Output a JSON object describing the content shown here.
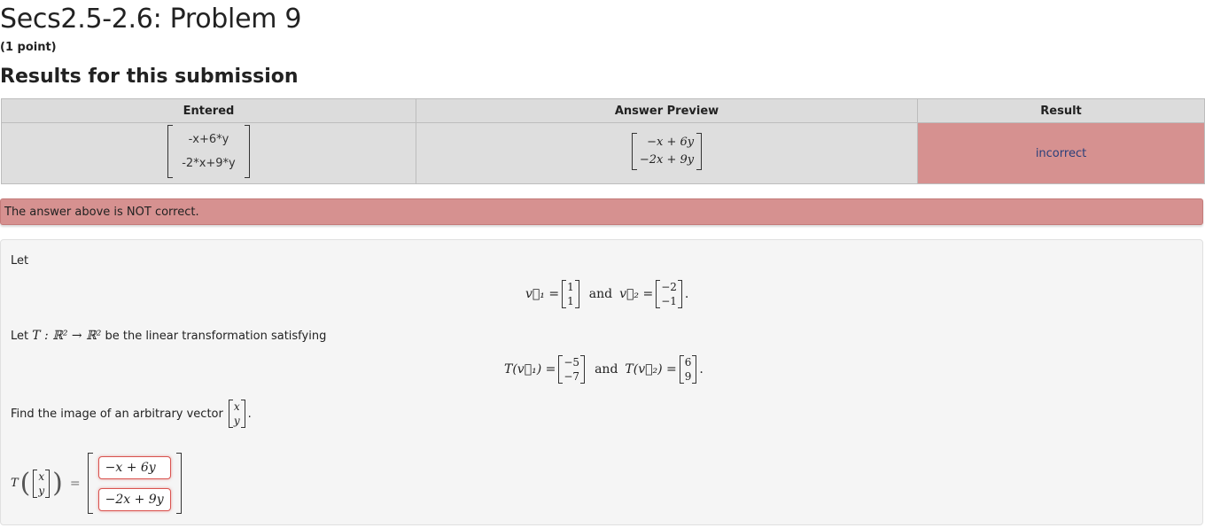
{
  "header": {
    "title": "Secs2.5-2.6: Problem 9",
    "points": "(1 point)",
    "results_heading": "Results for this submission"
  },
  "results_table": {
    "columns": [
      "Entered",
      "Answer Preview",
      "Result"
    ],
    "entered": [
      "-x+6*y",
      "-2*x+9*y"
    ],
    "preview": [
      "−x + 6y",
      "−2x + 9y"
    ],
    "result": "incorrect"
  },
  "alert": {
    "message": "The answer above is NOT correct."
  },
  "problem": {
    "intro": "Let",
    "v1_label": "v⃗₁ =",
    "v1": [
      "1",
      "1"
    ],
    "and1": "and",
    "v2_label": "v⃗₂ =",
    "v2": [
      "−2",
      "−1"
    ],
    "period1": ".",
    "transform_prefix": "Let ",
    "transform_math": "T : ℝ² → ℝ²",
    "transform_suffix": " be the linear transformation satisfying",
    "tv1_label": "T(v⃗₁) =",
    "tv1": [
      "−5",
      "−7"
    ],
    "and2": "and",
    "tv2_label": "T(v⃗₂) =",
    "tv2": [
      "6",
      "9"
    ],
    "period2": ".",
    "find_text": "Find the image of an arbitrary vector",
    "arb_vec": [
      "x",
      "y"
    ],
    "period3": ".",
    "answer_T": "T",
    "answer_eq": "=",
    "answer_inputs": [
      "−x + 6y",
      "−2x + 9y"
    ]
  },
  "colors": {
    "result_bg": "#d69190",
    "header_bg": "#dcdcdc",
    "problem_bg": "#f5f5f5",
    "input_border": "#d9534f"
  }
}
